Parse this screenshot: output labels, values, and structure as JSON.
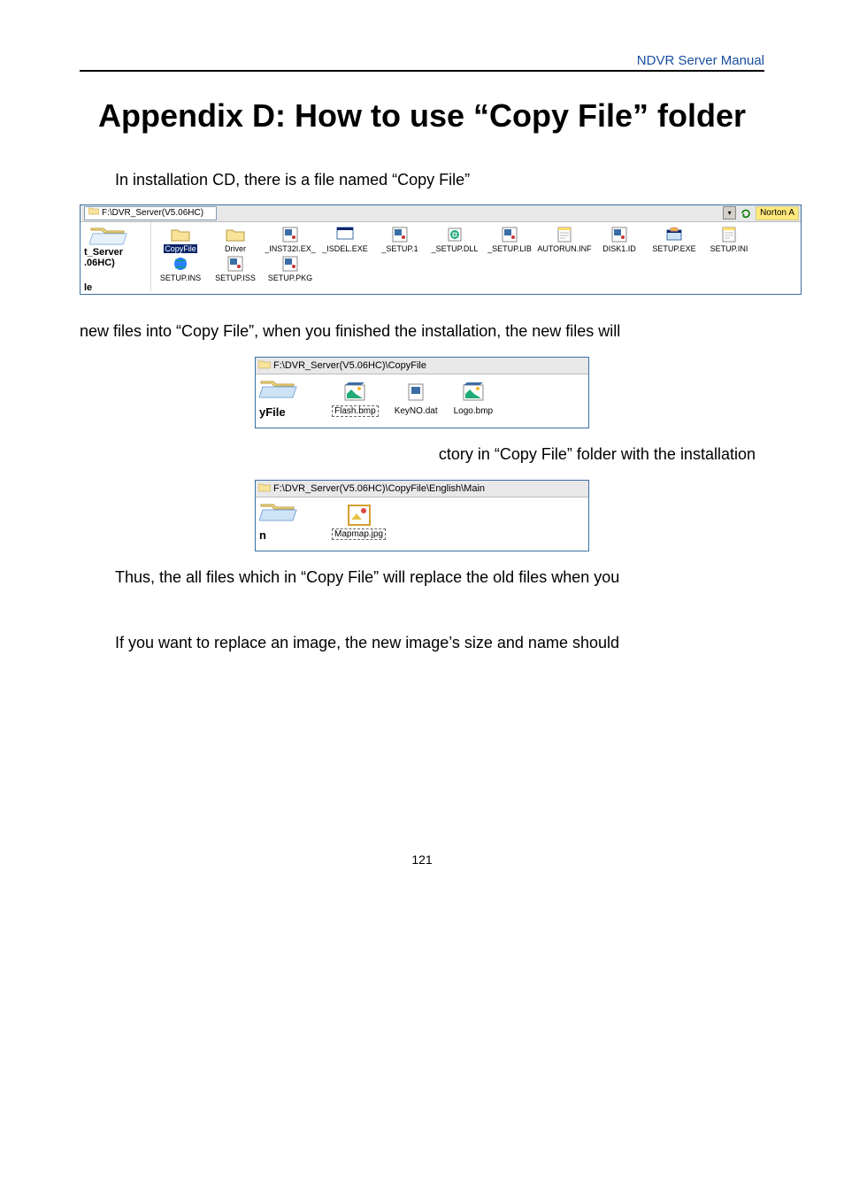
{
  "header": {
    "manual": "NDVR Server Manual"
  },
  "title": "Appendix D: How to use “Copy File” folder",
  "para1": "In installation CD, there is a file named “Copy File”",
  "para2": "new files into “Copy File”, when you finished the installation, the new files will",
  "para3": "ctory in “Copy File” folder with the installation",
  "para4": "Thus, the all files which in “Copy File” will replace the old files when you",
  "para5": "If you want to replace an image, the new image’s size and name should",
  "page_number": "121",
  "shot1": {
    "path": "F:\\DVR_Server(V5.06HC)",
    "norton": "Norton A",
    "side_label": "t_Server",
    "side_label2": ".06HC)",
    "side_bottom": "le",
    "files": [
      {
        "name": "CopyFile",
        "icon": "folder",
        "selected": true
      },
      {
        "name": "Driver",
        "icon": "folder"
      },
      {
        "name": "_INST32I.EX_",
        "icon": "app"
      },
      {
        "name": "_ISDEL.EXE",
        "icon": "isdel"
      },
      {
        "name": "_SETUP.1",
        "icon": "app"
      },
      {
        "name": "_SETUP.DLL",
        "icon": "dll"
      },
      {
        "name": "_SETUP.LIB",
        "icon": "app"
      },
      {
        "name": "AUTORUN.INF",
        "icon": "inf"
      },
      {
        "name": "DISK1.ID",
        "icon": "app"
      },
      {
        "name": "SETUP.EXE",
        "icon": "exe"
      },
      {
        "name": "SETUP.INI",
        "icon": "inf"
      },
      {
        "name": "SETUP.INS",
        "icon": "ins"
      },
      {
        "name": "SETUP.ISS",
        "icon": "app"
      },
      {
        "name": "SETUP.PKG",
        "icon": "app"
      }
    ]
  },
  "shot2": {
    "path": "F:\\DVR_Server(V5.06HC)\\CopyFile",
    "side_label": "yFile",
    "files": [
      {
        "name": "Flash.bmp",
        "icon": "bmp",
        "selected": true
      },
      {
        "name": "KeyNO.dat",
        "icon": "dat"
      },
      {
        "name": "Logo.bmp",
        "icon": "bmp"
      }
    ]
  },
  "shot3": {
    "path": "F:\\DVR_Server(V5.06HC)\\CopyFile\\English\\Main",
    "side_label": "n",
    "files": [
      {
        "name": "Mapmap.jpg",
        "icon": "jpg",
        "selected": true
      }
    ]
  }
}
